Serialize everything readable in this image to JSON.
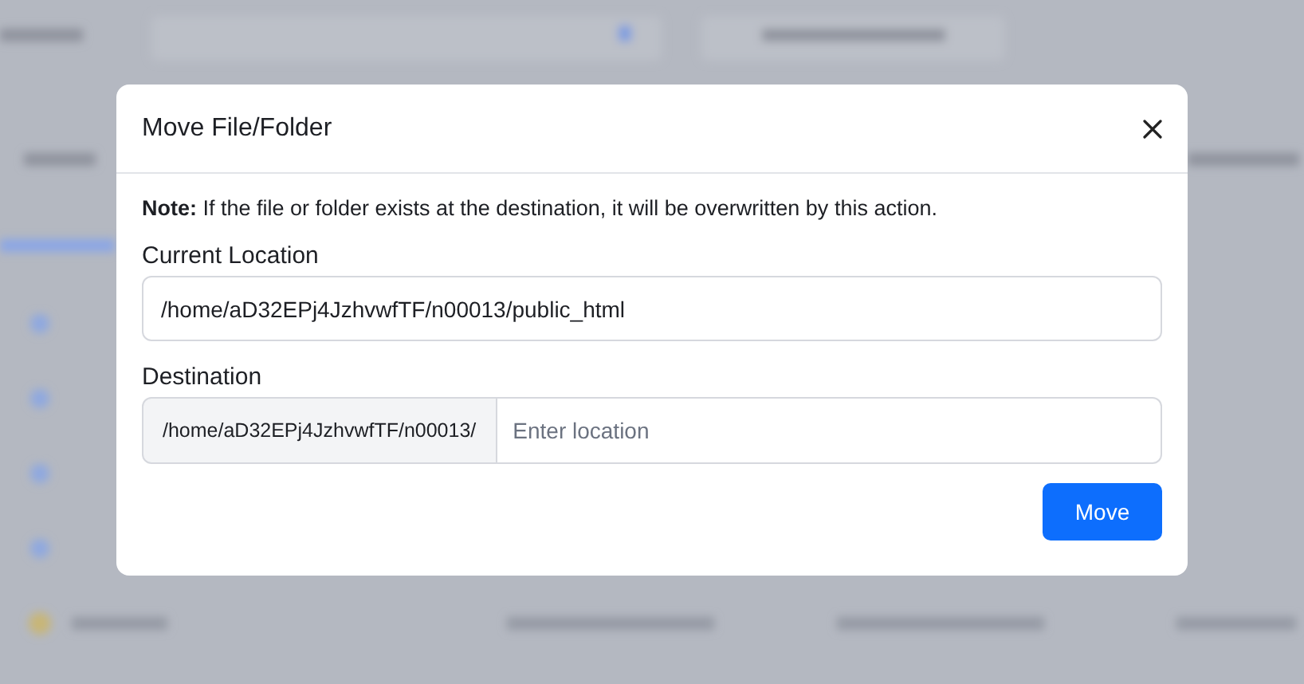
{
  "dialog": {
    "title": "Move File/Folder",
    "note": "**Note:** If the file or folder exists at the destination, it will be overwritten by this action.",
    "current_location": {
      "label": "Current Location",
      "value": "/home/aD32EPj4JzhvwfTF/n00013/public_html"
    },
    "destination": {
      "label": "Destination",
      "prefix": "/home/aD32EPj4JzhvwfTF/n00013/",
      "placeholder": "Enter location"
    },
    "buttons": [
      "Move"
    ]
  }
}
